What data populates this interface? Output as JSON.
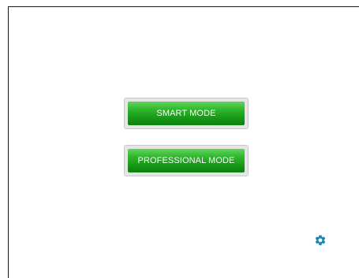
{
  "buttons": {
    "smart_mode": "SMART MODE",
    "professional_mode": "PROFESSIONAL MODE"
  },
  "icons": {
    "settings": "gear-icon"
  },
  "colors": {
    "button_green": "#1ea11c",
    "gear_blue": "#1a86b5"
  }
}
